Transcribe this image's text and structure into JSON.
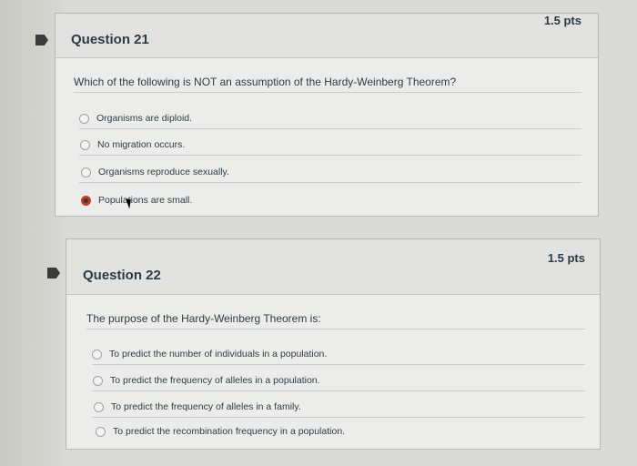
{
  "question21": {
    "title": "Question 21",
    "points": "1.5 pts",
    "text": "Which of the following is NOT an assumption of the Hardy-Weinberg Theorem?",
    "options": [
      {
        "label": "Organisms are diploid.",
        "selected": false
      },
      {
        "label": "No migration occurs.",
        "selected": false
      },
      {
        "label": "Organisms reproduce sexually.",
        "selected": false
      },
      {
        "label": "Populations are small.",
        "selected": true
      }
    ]
  },
  "question22": {
    "title": "Question 22",
    "points": "1.5 pts",
    "text": "The purpose of the Hardy-Weinberg Theorem is:",
    "options": [
      {
        "label": "To predict the number of individuals in a population.",
        "selected": false
      },
      {
        "label": "To predict the frequency of alleles in a population.",
        "selected": false
      },
      {
        "label": "To predict the frequency of alleles in a family.",
        "selected": false
      },
      {
        "label": "To predict the recombination frequency in a population.",
        "selected": false
      }
    ]
  },
  "colors": {
    "accent_selected": "#c0392b",
    "text": "#2d3b45",
    "border": "#b4b8ba"
  },
  "icons": {
    "flag": "flag-icon",
    "radio": "radio-button-icon",
    "cursor": "mouse-pointer-icon"
  }
}
